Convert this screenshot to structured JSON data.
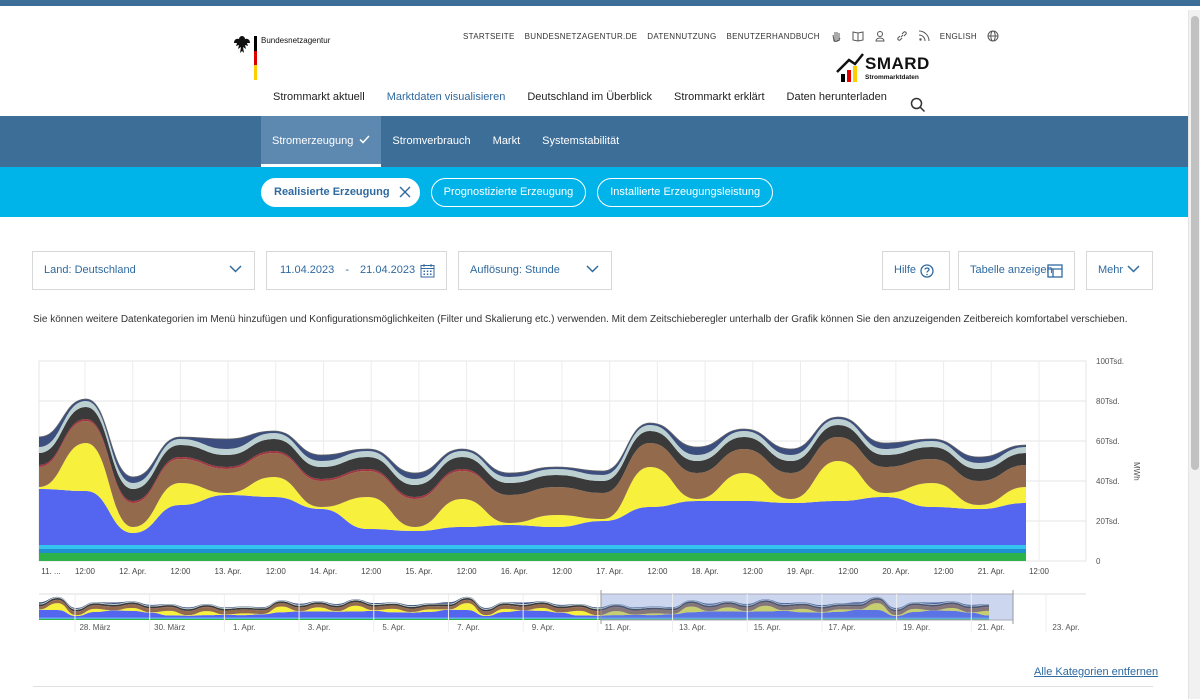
{
  "header": {
    "agency_name": "Bundesnetzagentur",
    "utility_links": [
      "STARTSEITE",
      "BUNDESNETZAGENTUR.DE",
      "DATENNUTZUNG",
      "BENUTZERHANDBUCH"
    ],
    "language_label": "ENGLISH",
    "brand_name": "SMARD",
    "brand_sub": "Strommarktdaten"
  },
  "main_nav": [
    {
      "label": "Strommarkt aktuell",
      "active": false
    },
    {
      "label": "Marktdaten visualisieren",
      "active": true
    },
    {
      "label": "Deutschland im Überblick",
      "active": false
    },
    {
      "label": "Strommarkt erklärt",
      "active": false
    },
    {
      "label": "Daten herunterladen",
      "active": false
    }
  ],
  "sub_nav": [
    {
      "label": "Stromerzeugung",
      "active": true
    },
    {
      "label": "Stromverbrauch",
      "active": false
    },
    {
      "label": "Markt",
      "active": false
    },
    {
      "label": "Systemstabilität",
      "active": false
    }
  ],
  "chips": [
    {
      "label": "Realisierte Erzeugung",
      "active": true
    },
    {
      "label": "Prognostizierte Erzeugung",
      "active": false
    },
    {
      "label": "Installierte Erzeugungsleistung",
      "active": false
    }
  ],
  "controls": {
    "country": "Land: Deutschland",
    "date_from": "11.04.2023",
    "date_sep": "-",
    "date_to": "21.04.2023",
    "resolution": "Auflösung: Stunde",
    "help": "Hilfe",
    "table": "Tabelle anzeigen",
    "more": "Mehr"
  },
  "info_text": "Sie können weitere Datenkategorien im Menü hinzufügen und Konfigurationsmöglichkeiten (Filter und Skalierung etc.) verwenden. Mit dem Zeitschieberegler unterhalb der Grafik können Sie den anzuzeigenden Zeitbereich komfortabel verschieben.",
  "footer": {
    "remove_all": "Alle Kategorien entfernen"
  },
  "colors": {
    "primary": "#3d6e98",
    "accent": "#00b4ea",
    "link": "#2f6aa0"
  },
  "chart_data": {
    "type": "area",
    "unit": "MWh",
    "ylim": [
      0,
      100000
    ],
    "y_ticks": [
      "100Tsd.",
      "80Tsd.",
      "60Tsd.",
      "40Tsd.",
      "20Tsd.",
      "0"
    ],
    "x_ticks": [
      "11. ...",
      "12:00",
      "12. Apr.",
      "12:00",
      "13. Apr.",
      "12:00",
      "14. Apr.",
      "12:00",
      "15. Apr.",
      "12:00",
      "16. Apr.",
      "12:00",
      "17. Apr.",
      "12:00",
      "18. Apr.",
      "12:00",
      "19. Apr.",
      "12:00",
      "20. Apr.",
      "12:00",
      "21. Apr.",
      "12:00"
    ],
    "navigator_ticks": [
      "28. März",
      "30. März",
      "1. Apr.",
      "3. Apr.",
      "5. Apr.",
      "7. Apr.",
      "9. Apr.",
      "11. Apr.",
      "13. Apr.",
      "15. Apr.",
      "17. Apr.",
      "19. Apr.",
      "21. Apr.",
      "23. Apr."
    ],
    "x": [
      "11.04. 00:00",
      "11.04. 12:00",
      "12.04. 00:00",
      "12.04. 12:00",
      "13.04. 00:00",
      "13.04. 12:00",
      "14.04. 00:00",
      "14.04. 12:00",
      "15.04. 00:00",
      "15.04. 12:00",
      "16.04. 00:00",
      "16.04. 12:00",
      "17.04. 00:00",
      "17.04. 12:00",
      "18.04. 00:00",
      "18.04. 12:00",
      "19.04. 00:00",
      "19.04. 12:00",
      "20.04. 00:00",
      "20.04. 12:00",
      "21.04. 00:00",
      "21.04. 12:00"
    ],
    "series": [
      {
        "color": "#2db24a",
        "values": [
          4000,
          4000,
          4000,
          4000,
          4000,
          4000,
          4000,
          4000,
          4000,
          4000,
          4000,
          4000,
          4000,
          4000,
          4000,
          4000,
          4000,
          4000,
          4000,
          4000,
          4000,
          4000
        ]
      },
      {
        "color": "#1f8fd1",
        "values": [
          2000,
          2000,
          2000,
          2000,
          2000,
          2000,
          2000,
          2000,
          2000,
          2000,
          2000,
          2000,
          2000,
          2000,
          2000,
          2000,
          2000,
          2000,
          2000,
          2000,
          2000,
          2000
        ]
      },
      {
        "color": "#35c3f0",
        "values": [
          2000,
          2000,
          2000,
          2000,
          2000,
          2000,
          2000,
          2000,
          2000,
          2000,
          2000,
          2000,
          2000,
          2000,
          2000,
          2000,
          2000,
          2000,
          2000,
          2000,
          2000,
          2000
        ]
      },
      {
        "color": "#5466f0",
        "values": [
          28000,
          27000,
          6000,
          20000,
          25000,
          24000,
          18000,
          8000,
          7000,
          9000,
          10000,
          9000,
          12000,
          19000,
          22000,
          22000,
          21000,
          22000,
          24000,
          19000,
          18000,
          21000
        ]
      },
      {
        "color": "#f7f13d",
        "values": [
          1000,
          24000,
          3000,
          11000,
          1000,
          10000,
          1000,
          16000,
          2000,
          14000,
          1000,
          6000,
          1000,
          20000,
          1000,
          14000,
          2000,
          20000,
          2000,
          12000,
          2000,
          8000
        ]
      },
      {
        "color": "#936b4c",
        "values": [
          10000,
          11000,
          12000,
          12000,
          12000,
          12000,
          13000,
          13000,
          14000,
          14000,
          14000,
          14000,
          13000,
          12000,
          13000,
          12000,
          13000,
          12000,
          13000,
          12000,
          12000,
          11000
        ]
      },
      {
        "color": "#a0363f",
        "values": [
          1000,
          1000,
          1000,
          1000,
          1000,
          1000,
          1000,
          1000,
          1000,
          1000,
          0,
          0,
          0,
          0,
          0,
          0,
          0,
          0,
          0,
          0,
          0,
          0
        ]
      },
      {
        "color": "#3a3a3a",
        "values": [
          6000,
          6000,
          6000,
          6000,
          6000,
          6000,
          6000,
          6000,
          6000,
          6000,
          6000,
          6000,
          6000,
          6000,
          6000,
          6000,
          6000,
          6000,
          6000,
          6000,
          6000,
          6000
        ]
      },
      {
        "color": "#bcd0d2",
        "values": [
          3000,
          3000,
          3000,
          3000,
          3000,
          3000,
          3000,
          3000,
          3000,
          3000,
          3000,
          3000,
          3000,
          3000,
          3000,
          3000,
          3000,
          3000,
          3000,
          3000,
          3000,
          3000
        ]
      },
      {
        "color": "#3c4e7e",
        "values": [
          5000,
          1000,
          3000,
          1000,
          5000,
          1000,
          3000,
          1000,
          3000,
          1000,
          2000,
          1000,
          2000,
          1000,
          4000,
          1000,
          3000,
          1000,
          3000,
          1000,
          3000,
          1000
        ]
      }
    ],
    "grid": true
  }
}
